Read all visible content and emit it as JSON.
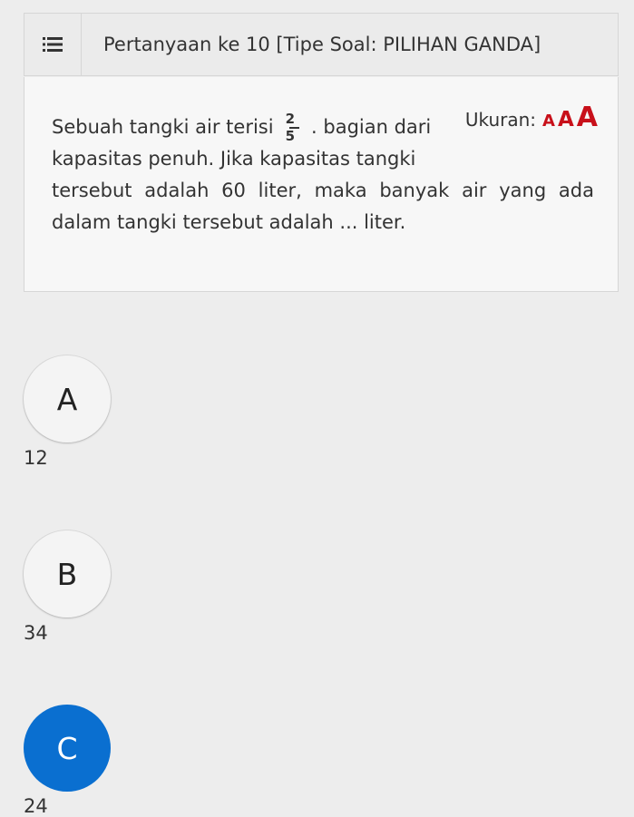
{
  "header": {
    "menu_icon": "list-icon",
    "title": "Pertanyaan ke 10 [Tipe Soal: PILIHAN GANDA]"
  },
  "question": {
    "part_before_fraction": "Sebuah tangki air terisi",
    "fraction_numerator": "2",
    "fraction_denominator": "5",
    "part_after_fraction": ". bagian dari",
    "line2": "kapasitas penuh. Jika kapasitas tangki",
    "line3": "tersebut adalah 60 liter, maka banyak air yang ada",
    "line4": "dalam tangki tersebut adalah ... liter."
  },
  "font_size_control": {
    "label": "Ukuran:",
    "small": "A",
    "medium": "A",
    "large": "A",
    "accent_color": "#c8101a"
  },
  "options": [
    {
      "letter": "A",
      "value": "12",
      "selected": false
    },
    {
      "letter": "B",
      "value": "34",
      "selected": false
    },
    {
      "letter": "C",
      "value": "24",
      "selected": true
    }
  ],
  "colors": {
    "selected": "#0a6fd0",
    "background": "#ededed"
  }
}
